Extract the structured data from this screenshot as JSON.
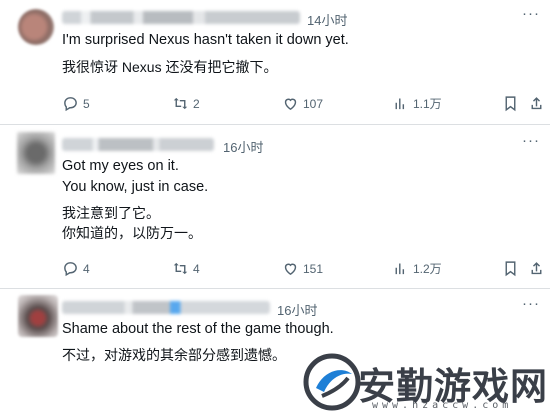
{
  "tweets": [
    {
      "time": "14小时",
      "lines": [
        "I'm surprised Nexus hasn't taken it down yet."
      ],
      "translation": [
        "我很惊讶 Nexus 还没有把它撤下。"
      ],
      "stats": {
        "replies": "5",
        "retweets": "2",
        "likes": "107",
        "views": "1.1万"
      }
    },
    {
      "time": "16小时",
      "lines": [
        "Got my eyes on it.",
        "You know, just in case."
      ],
      "translation": [
        "我注意到了它。",
        "你知道的，以防万一。"
      ],
      "stats": {
        "replies": "4",
        "retweets": "4",
        "likes": "151",
        "views": "1.2万"
      }
    },
    {
      "time": "16小时",
      "lines": [
        "Shame about the rest of the game though."
      ],
      "translation": [
        "不过，对游戏的其余部分感到遗憾。"
      ],
      "stats": {
        "replies": "",
        "retweets": "",
        "likes": "",
        "views": ""
      }
    }
  ],
  "more_glyph": "···",
  "watermark": {
    "brand": "安勤游戏网",
    "url": "www.hzaccw.com"
  },
  "colors": {
    "text": "#0f1419",
    "muted": "#536471",
    "divider": "#dcdfe2",
    "watermark_blue": "#1e7fd6"
  },
  "icons": [
    "reply-icon",
    "retweet-icon",
    "like-icon",
    "views-icon",
    "bookmark-icon",
    "share-icon"
  ]
}
